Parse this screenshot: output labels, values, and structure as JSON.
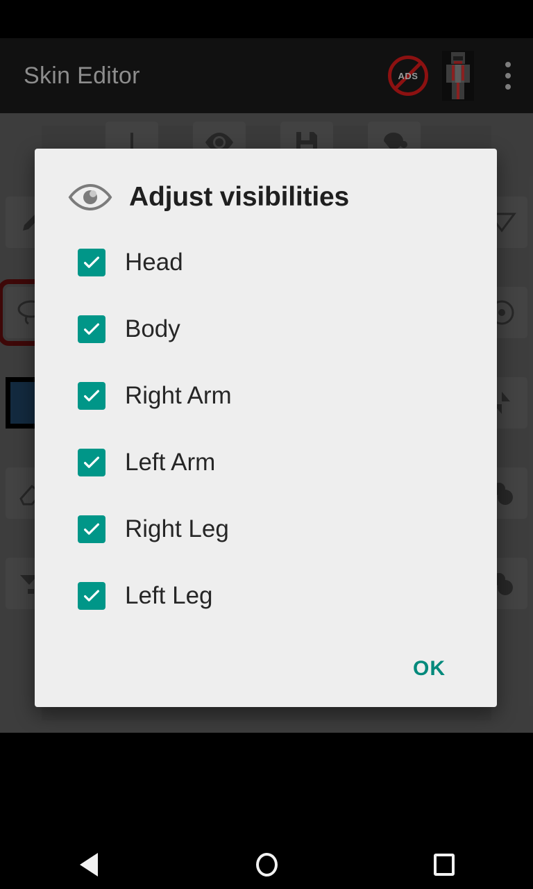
{
  "app_bar": {
    "title": "Skin Editor",
    "actions": [
      {
        "name": "no-ads-icon",
        "label": "ADS"
      },
      {
        "name": "skin-preview-icon",
        "label": ""
      },
      {
        "name": "overflow-menu-icon",
        "label": ""
      }
    ]
  },
  "editor": {
    "top_tools": [
      {
        "name": "undo-tool",
        "icon": "undo-icon"
      },
      {
        "name": "visibility-tool",
        "icon": "eye-icon"
      },
      {
        "name": "save-tool",
        "icon": "floppy-disk-icon"
      },
      {
        "name": "fill-tool",
        "icon": "paint-bucket-icon"
      }
    ],
    "left_tools": [
      {
        "name": "pencil-tool",
        "icon": "pencil-icon",
        "selected": false
      },
      {
        "name": "lasso-tool",
        "icon": "lasso-icon",
        "selected": true
      },
      {
        "name": "color-swatch",
        "icon": "color-swatch-icon",
        "color": "#1d3f5e",
        "selected": false
      },
      {
        "name": "eraser-tool",
        "icon": "eraser-icon",
        "selected": false
      },
      {
        "name": "shape-tool",
        "icon": "shape-icon",
        "selected": false
      }
    ],
    "right_tools": [
      {
        "name": "perspective-tool",
        "icon": "perspective-icon"
      },
      {
        "name": "rotate-tool",
        "icon": "rotate-icon"
      },
      {
        "name": "mirror-tool",
        "icon": "mirror-icon"
      },
      {
        "name": "noise-tool",
        "icon": "noise-icon"
      },
      {
        "name": "blur-tool",
        "icon": "blur-icon"
      }
    ]
  },
  "dialog": {
    "icon": "eye-icon",
    "title": "Adjust visibilities",
    "items": [
      {
        "label": "Head",
        "checked": true
      },
      {
        "label": "Body",
        "checked": true
      },
      {
        "label": "Right Arm",
        "checked": true
      },
      {
        "label": "Left Arm",
        "checked": true
      },
      {
        "label": "Right Leg",
        "checked": true
      },
      {
        "label": "Left Leg",
        "checked": true
      }
    ],
    "ok_label": "OK"
  },
  "nav_bar": {
    "back": "back-icon",
    "home": "home-icon",
    "recents": "recents-icon"
  },
  "colors": {
    "accent": "#009688",
    "ok_text": "#00897b",
    "dialog_bg": "#eeeeee",
    "app_bar_bg": "#111111",
    "editor_bg": "#5b5b5b",
    "selected_tool_border": "#5c0d0d",
    "swatch": "#1d3f5e"
  }
}
